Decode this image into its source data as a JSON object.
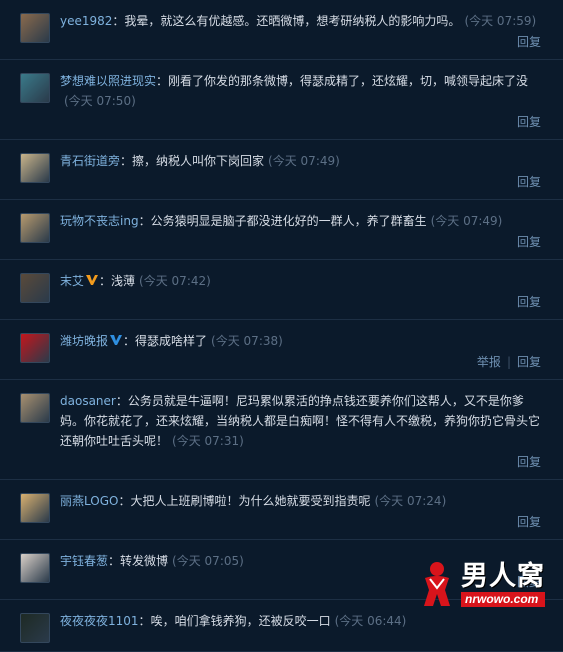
{
  "comments": [
    {
      "user": "yee1982",
      "text": "我晕，就这么有优越感。还晒微博，想考研纳税人的影响力吗。",
      "time": "(今天 07:59)",
      "actions": [
        "回复"
      ],
      "avatar_color": "#8a6a4c"
    },
    {
      "user": "梦想难以照进现实",
      "text": "刚看了你发的那条微博，得瑟成精了，还炫耀，切，喊领导起床了没",
      "time": "(今天 07:50)",
      "actions": [
        "回复"
      ],
      "avatar_color": "#3a7a8a"
    },
    {
      "user": "青石街道旁",
      "text": "擦，纳税人叫你下岗回家",
      "time": "(今天 07:49)",
      "actions": [
        "回复"
      ],
      "avatar_color": "#c9b48a"
    },
    {
      "user": "玩物不丧志ing",
      "text": "公务猿明显是脑子都没进化好的一群人，养了群畜生",
      "time": "(今天 07:49)",
      "actions": [
        "回复"
      ],
      "avatar_color": "#b79a6e"
    },
    {
      "user": "末艾",
      "badge": "orange",
      "text": "浅薄",
      "time": "(今天 07:42)",
      "actions": [
        "回复"
      ],
      "avatar_color": "#5a4a3a"
    },
    {
      "user": "潍坊晚报",
      "badge": "blue",
      "text": "得瑟成啥样了",
      "time": "(今天 07:38)",
      "actions": [
        "举报",
        "回复"
      ],
      "avatar_color": "#c4161c"
    },
    {
      "user": "daosaner",
      "text": "公务员就是牛逼啊！尼玛累似累活的挣点钱还要养你们这帮人，又不是你爹妈。你花就花了，还来炫耀，当纳税人都是白痴啊！怪不得有人不缴税，养狗你扔它骨头它还朝你吐吐舌头呢！",
      "time": "(今天 07:31)",
      "actions": [
        "回复"
      ],
      "avatar_color": "#a89070"
    },
    {
      "user": "丽燕LOGO",
      "text": "大把人上班刷博啦！为什么她就要受到指责呢",
      "time": "(今天 07:24)",
      "actions": [
        "回复"
      ],
      "avatar_color": "#d8b070"
    },
    {
      "user": "宇钰春葱",
      "text": "转发微博",
      "time": "(今天 07:05)",
      "actions": [
        "回复"
      ],
      "avatar_color": "#d9d0c8"
    },
    {
      "user": "夜夜夜夜1101",
      "text": "唉，咱们拿钱养狗，还被反咬一口",
      "time": "(今天 06:44)",
      "actions": [],
      "avatar_color": "#1e2a24"
    }
  ],
  "watermark": {
    "brand": "男人窝",
    "url": "nrwowo.com"
  },
  "colors": {
    "background": "#0b1a2b",
    "username": "#7fb2de",
    "time": "#5c6f85",
    "action": "#6e8fb0",
    "badge_orange": "#f29b1d",
    "badge_blue": "#2f8fe0",
    "logo_red": "#d8141b"
  }
}
